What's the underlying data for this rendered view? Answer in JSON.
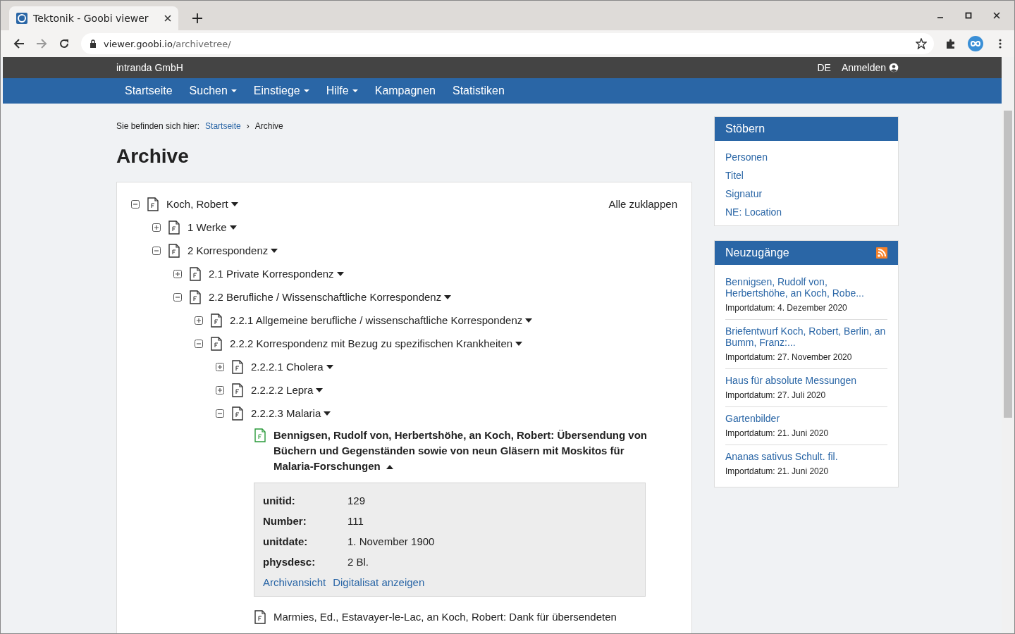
{
  "browser": {
    "tab_title": "Tektonik - Goobi viewer",
    "url_host": "viewer.goobi.io",
    "url_path": "/archivetree/"
  },
  "topbar": {
    "brand": "intranda GmbH",
    "language": "DE",
    "login": "Anmelden"
  },
  "nav": [
    {
      "label": "Startseite",
      "dropdown": false
    },
    {
      "label": "Suchen",
      "dropdown": true
    },
    {
      "label": "Einstiege",
      "dropdown": true
    },
    {
      "label": "Hilfe",
      "dropdown": true
    },
    {
      "label": "Kampagnen",
      "dropdown": false
    },
    {
      "label": "Statistiken",
      "dropdown": false
    }
  ],
  "breadcrumb": {
    "prefix": "Sie befinden sich hier:",
    "separator": "›",
    "items": [
      "Startseite",
      "Archive"
    ]
  },
  "page_title": "Archive",
  "tree": {
    "collapse_all": "Alle zuklappen",
    "nodes": [
      {
        "kind": "group",
        "label": "Koch, Robert",
        "expanded": true,
        "children": [
          {
            "kind": "group",
            "label": "1 Werke",
            "expanded": false
          },
          {
            "kind": "group",
            "label": "2 Korrespondenz",
            "expanded": true,
            "children": [
              {
                "kind": "group",
                "label": "2.1 Private Korrespondenz",
                "expanded": false
              },
              {
                "kind": "group",
                "label": "2.2 Berufliche / Wissenschaftliche Korrespondenz",
                "expanded": true,
                "children": [
                  {
                    "kind": "group",
                    "label": "2.2.1 Allgemeine berufliche / wissenschaftliche Korrespondenz",
                    "expanded": false
                  },
                  {
                    "kind": "group",
                    "label": "2.2.2 Korrespondenz mit Bezug zu spezifischen Krankheiten",
                    "expanded": true,
                    "children": [
                      {
                        "kind": "group",
                        "label": "2.2.2.1 Cholera",
                        "expanded": false
                      },
                      {
                        "kind": "group",
                        "label": "2.2.2.2 Lepra",
                        "expanded": false
                      },
                      {
                        "kind": "group",
                        "label": "2.2.2.3 Malaria",
                        "expanded": true,
                        "children": [
                          {
                            "kind": "record",
                            "label": "Bennigsen, Rudolf von, Herbertshöhe, an Koch, Robert: Übersendung von Büchern und Gegenständen sowie von neun Gläsern mit Moskitos für Malaria-Forschungen",
                            "selected": true,
                            "details": {
                              "fields": [
                                {
                                  "name": "unitid:",
                                  "value": "129"
                                },
                                {
                                  "name": "Number:",
                                  "value": "111"
                                },
                                {
                                  "name": "unitdate:",
                                  "value": "1. November 1900"
                                },
                                {
                                  "name": "physdesc:",
                                  "value": "2 Bl."
                                }
                              ],
                              "links": [
                                "Archivansicht",
                                "Digitalisat anzeigen"
                              ]
                            }
                          },
                          {
                            "kind": "record",
                            "label": "Marmies, Ed., Estavayer-le-Lac, an Koch, Robert: Dank für übersendeten",
                            "selected": false
                          }
                        ]
                      }
                    ]
                  }
                ]
              }
            ]
          }
        ]
      }
    ]
  },
  "sidebar": {
    "browse": {
      "title": "Stöbern",
      "links": [
        "Personen",
        "Titel",
        "Signatur",
        "NE: Location"
      ]
    },
    "new": {
      "title": "Neuzugänge",
      "items": [
        {
          "title": "Bennigsen, Rudolf von, Herbertshöhe, an Koch, Robe...",
          "date": "Importdatum: 4. Dezember 2020"
        },
        {
          "title": "Briefentwurf Koch, Robert, Berlin, an Bumm, Franz:...",
          "date": "Importdatum: 27. November 2020"
        },
        {
          "title": "Haus für absolute Messungen",
          "date": "Importdatum: 27. Juli 2020"
        },
        {
          "title": "Gartenbilder",
          "date": "Importdatum: 21. Juni 2020"
        },
        {
          "title": "Ananas sativus Schult. fil.",
          "date": "Importdatum: 21. Juni 2020"
        }
      ]
    }
  }
}
